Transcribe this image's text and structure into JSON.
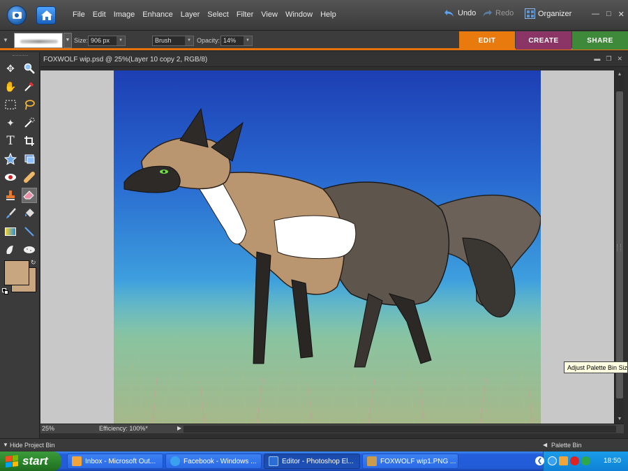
{
  "menubar": {
    "items": [
      "File",
      "Edit",
      "Image",
      "Enhance",
      "Layer",
      "Select",
      "Filter",
      "View",
      "Window",
      "Help"
    ],
    "undo": "Undo",
    "redo": "Redo",
    "organizer": "Organizer"
  },
  "options": {
    "size_label": "Size:",
    "size_value": "906 px",
    "mode_value": "Brush",
    "opacity_label": "Opacity:",
    "opacity_value": "14%"
  },
  "mode_tabs": [
    {
      "label": "EDIT",
      "color": "#e97a0e"
    },
    {
      "label": "CREATE",
      "color": "#8a3566"
    },
    {
      "label": "SHARE",
      "color": "#3f8a3a"
    }
  ],
  "document": {
    "title": "FOXWOLF wip.psd @ 25%(Layer 10 copy 2, RGB/8)",
    "zoom": "25%",
    "efficiency": "Efficiency: 100%*"
  },
  "tooltip": "Adjust Palette Bin Size",
  "bins": {
    "hide_project_bin": "Hide Project Bin",
    "palette_bin": "Palette Bin"
  },
  "colors": {
    "foreground": "#c8a780",
    "background": "#c8a780",
    "accent": "#e8720c"
  },
  "taskbar": {
    "start": "start",
    "tasks": [
      {
        "label": "Inbox - Microsoft Out...",
        "icon": "outlook-icon"
      },
      {
        "label": "Facebook - Windows ...",
        "icon": "ie-icon"
      },
      {
        "label": "Editor - Photoshop El...",
        "icon": "photoshop-icon"
      },
      {
        "label": "FOXWOLF wip1.PNG ...",
        "icon": "image-viewer-icon"
      }
    ],
    "clock": "18:50"
  }
}
